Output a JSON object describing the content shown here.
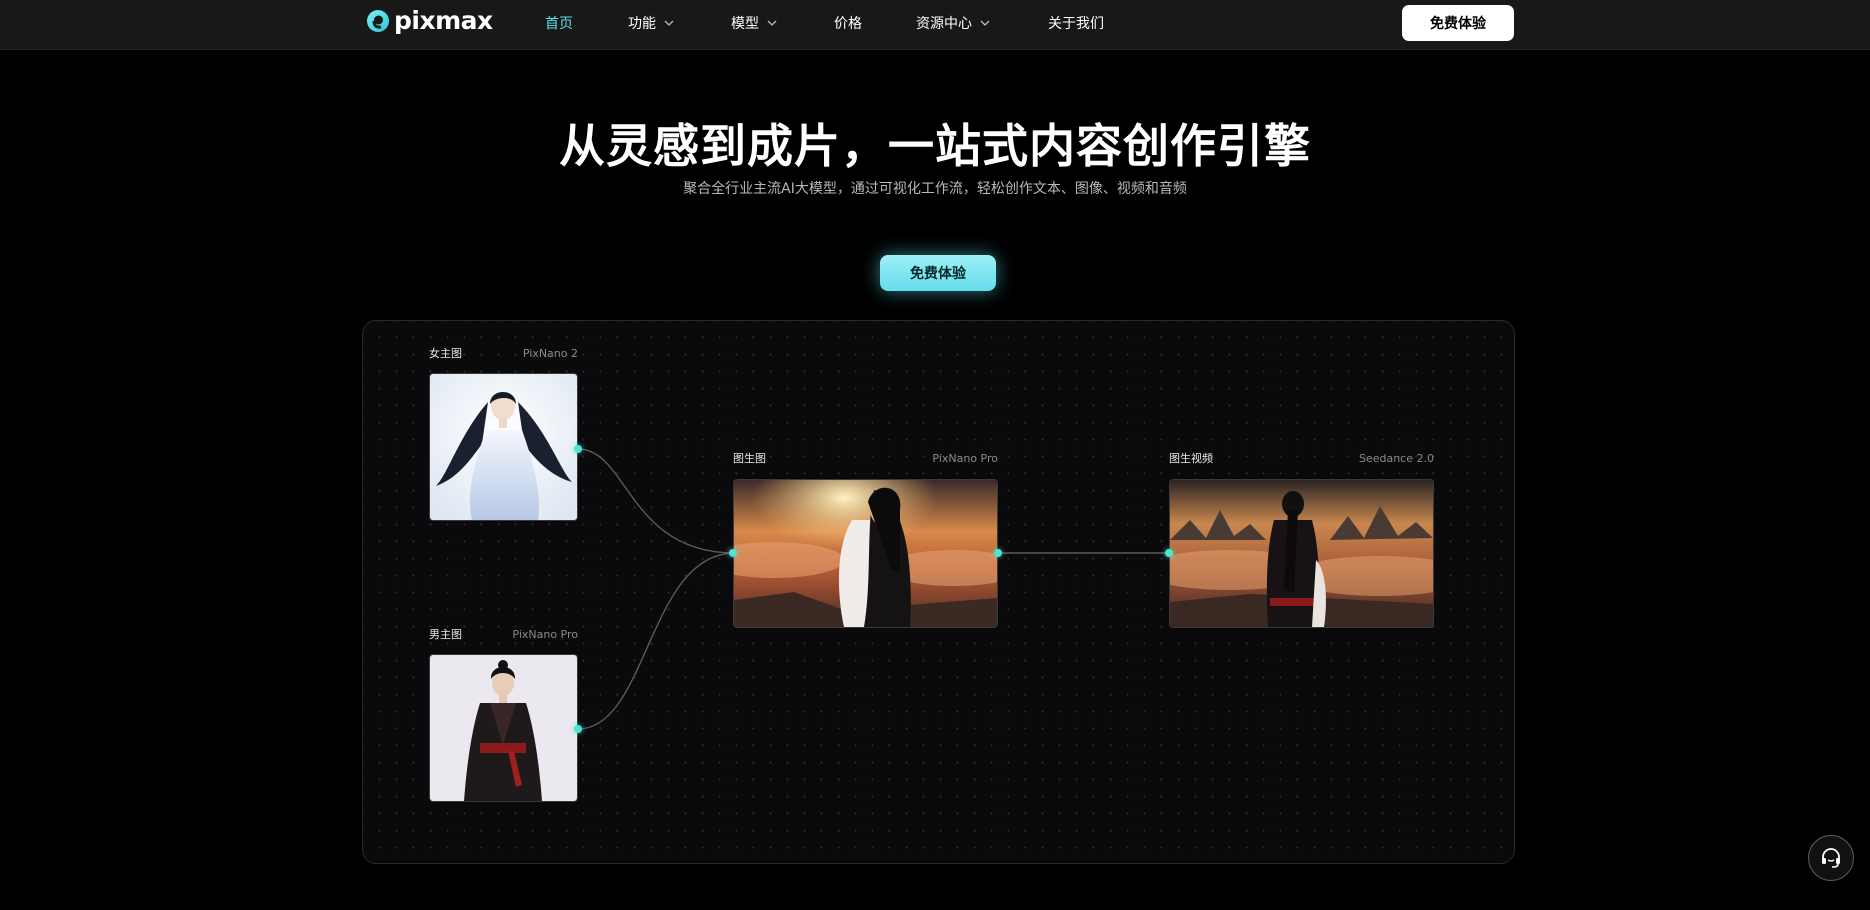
{
  "brand": {
    "name": "pixmax",
    "accent": "#5ee0ea"
  },
  "nav": {
    "items": [
      {
        "label": "首页",
        "active": true,
        "dropdown": false
      },
      {
        "label": "功能",
        "active": false,
        "dropdown": true
      },
      {
        "label": "模型",
        "active": false,
        "dropdown": true
      },
      {
        "label": "价格",
        "active": false,
        "dropdown": false
      },
      {
        "label": "资源中心",
        "active": false,
        "dropdown": true
      },
      {
        "label": "关于我们",
        "active": false,
        "dropdown": false
      }
    ],
    "cta_label": "免费体验"
  },
  "hero": {
    "title": "从灵感到成片，一站式内容创作引擎",
    "subtitle": "聚合全行业主流AI大模型，通过可视化工作流，轻松创作文本、图像、视频和音频",
    "cta_label": "免费体验"
  },
  "workflow": {
    "nodes": [
      {
        "label": "女主图",
        "model": "PixNano 2",
        "image": "woman-portrait"
      },
      {
        "label": "男主图",
        "model": "PixNano Pro",
        "image": "man-portrait"
      },
      {
        "label": "图生图",
        "model": "PixNano Pro",
        "image": "couple-embrace-sunset"
      },
      {
        "label": "图生视频",
        "model": "Seedance 2.0",
        "image": "couple-back-view-clouds"
      }
    ]
  },
  "support": {
    "icon": "headset-icon"
  }
}
